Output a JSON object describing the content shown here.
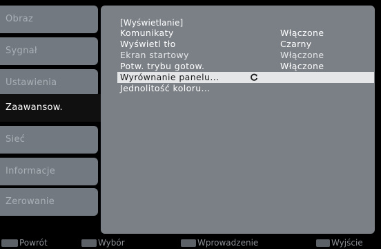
{
  "sidebar": {
    "tabs": [
      {
        "label": "Obraz"
      },
      {
        "label": "Sygnał"
      },
      {
        "label": "Ustawienia"
      },
      {
        "label": "Zaawansow."
      },
      {
        "label": "Sieć"
      },
      {
        "label": "Informacje"
      },
      {
        "label": "Zerowanie"
      }
    ],
    "active_index": 3
  },
  "panel": {
    "section_title": "[Wyświetlanie]",
    "items": [
      {
        "label": "Komunikaty",
        "value": "Włączone"
      },
      {
        "label": "Wyświetl tło",
        "value": "Czarny"
      },
      {
        "label": "Ekran startowy",
        "value": "Włączone"
      },
      {
        "label": "Potw. trybu gotow.",
        "value": "Włączone"
      },
      {
        "label": "Wyrównanie panelu...",
        "value": ""
      },
      {
        "label": "Jednolitość koloru...",
        "value": ""
      }
    ],
    "selected_index": 4,
    "selected_icon": "refresh-icon"
  },
  "bottom_bar": {
    "hints": [
      {
        "key_icon": "esc-key-icon",
        "label": "Powrót"
      },
      {
        "key_icon": "enter-key-icon",
        "label": "Wybór"
      },
      {
        "key_icon": "menu-key-icon",
        "label": "Wprowadzenie"
      },
      {
        "key_icon": "menu-key-icon",
        "label": "Wyjście"
      }
    ]
  },
  "colors": {
    "background": "#000000",
    "panel": "#7b8087",
    "tab": "#737980",
    "active_tab": "#101010",
    "selection": "#e4e6e8"
  }
}
